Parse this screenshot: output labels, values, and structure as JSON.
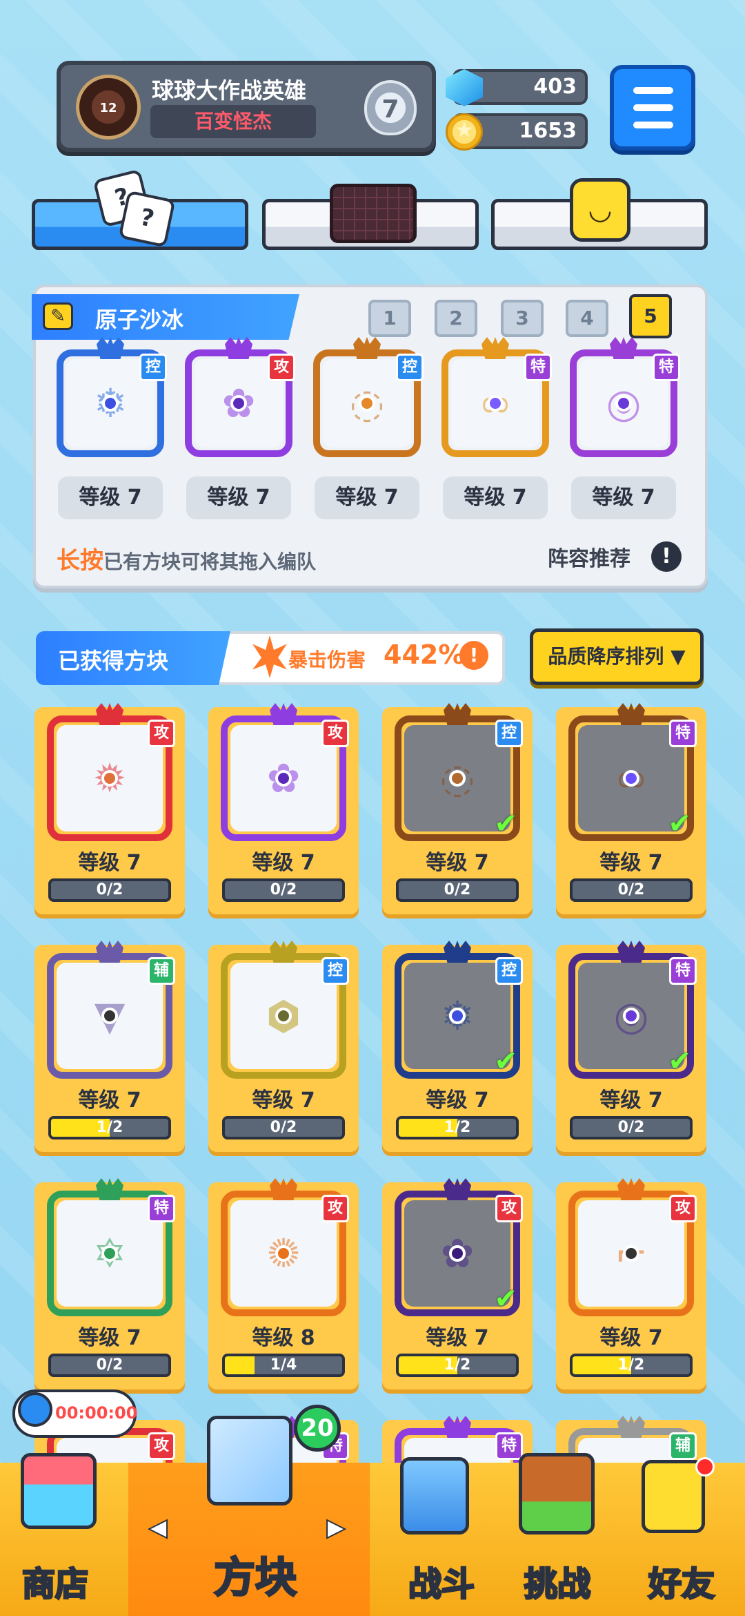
{
  "profile": {
    "level_badge": "12",
    "name": "球球大作战英雄",
    "title": "百变怪杰",
    "rank": "7"
  },
  "currency": {
    "gems": "403",
    "coins": "1653"
  },
  "team": {
    "name": "原子沙冰",
    "slots": [
      "1",
      "2",
      "3",
      "4",
      "5"
    ],
    "active_slot": "5",
    "cards": [
      {
        "tag": "控",
        "level": "等级 7",
        "color": "#2f6fe0",
        "emblem": "❄",
        "dot": "#3c4fe0"
      },
      {
        "tag": "攻",
        "level": "等级 7",
        "color": "#8e3ee0",
        "emblem": "✿",
        "dot": "#5b2ab8"
      },
      {
        "tag": "控",
        "level": "等级 7",
        "color": "#c9741f",
        "emblem": "◌",
        "dot": "#e58a2a"
      },
      {
        "tag": "特",
        "level": "等级 7",
        "color": "#e59a1f",
        "emblem": "∞",
        "dot": "#7a5cff"
      },
      {
        "tag": "特",
        "level": "等级 7",
        "color": "#9a3ed8",
        "emblem": "◎",
        "dot": "#6a3ad8"
      }
    ],
    "hint_strong": "长按",
    "hint_rest": "已有方块可将其拖入编队",
    "recommend": "阵容推荐",
    "excl": "!"
  },
  "acquired": {
    "title": "已获得方块",
    "crit_label": "暴击伤害",
    "crit_value": "442%",
    "excl": "!",
    "sort_label": "品质降序排列 ▼",
    "cards": [
      {
        "tag": "攻",
        "level": "等级 7",
        "progress": "0/2",
        "fill": 0,
        "color": "#e0303a",
        "emblem": "✹",
        "dot": "#e0703a",
        "dim": false
      },
      {
        "tag": "攻",
        "level": "等级 7",
        "progress": "0/2",
        "fill": 0,
        "color": "#8e3ee0",
        "emblem": "✿",
        "dot": "#5b2ab8",
        "dim": false
      },
      {
        "tag": "控",
        "level": "等级 7",
        "progress": "0/2",
        "fill": 0,
        "color": "#8a4a1a",
        "emblem": "◌",
        "dot": "#b06a30",
        "dim": true
      },
      {
        "tag": "特",
        "level": "等级 7",
        "progress": "0/2",
        "fill": 0,
        "color": "#8a4a1a",
        "emblem": "∞",
        "dot": "#6a50ff",
        "dim": true
      },
      {
        "tag": "辅",
        "level": "等级 7",
        "progress": "1/2",
        "fill": 0.5,
        "color": "#6a5aa8",
        "emblem": "▼",
        "dot": "#333",
        "dim": false
      },
      {
        "tag": "控",
        "level": "等级 7",
        "progress": "0/2",
        "fill": 0,
        "color": "#b8a020",
        "emblem": "⬢",
        "dot": "#6b6a30",
        "dim": false
      },
      {
        "tag": "控",
        "level": "等级 7",
        "progress": "1/2",
        "fill": 0.5,
        "color": "#1f3d8a",
        "emblem": "❄",
        "dot": "#3c4fe0",
        "dim": true
      },
      {
        "tag": "特",
        "level": "等级 7",
        "progress": "0/2",
        "fill": 0,
        "color": "#4a2a8a",
        "emblem": "◎",
        "dot": "#6a3ad8",
        "dim": true
      },
      {
        "tag": "特",
        "level": "等级 7",
        "progress": "0/2",
        "fill": 0,
        "color": "#2ea05a",
        "emblem": "✡",
        "dot": "#2ea05a",
        "dim": false
      },
      {
        "tag": "攻",
        "level": "等级 8",
        "progress": "1/4",
        "fill": 0.25,
        "color": "#e8721a",
        "emblem": "✺",
        "dot": "#e8721a",
        "dim": false
      },
      {
        "tag": "攻",
        "level": "等级 7",
        "progress": "1/2",
        "fill": 0.5,
        "color": "#4a2a8a",
        "emblem": "✿",
        "dot": "#3a1a7a",
        "dim": true
      },
      {
        "tag": "攻",
        "level": "等级 7",
        "progress": "1/2",
        "fill": 0.5,
        "color": "#e8721a",
        "emblem": "⌐",
        "dot": "#333",
        "dim": false
      },
      {
        "tag": "攻",
        "color": "#e0303a",
        "emblem": "",
        "dot": "#e0303a",
        "dim": false
      },
      {
        "tag": "特",
        "color": "#9a3ed8",
        "emblem": "",
        "dot": "#9a3ed8",
        "dim": false
      },
      {
        "tag": "特",
        "color": "#8e3ee0",
        "emblem": "",
        "dot": "#8e3ee0",
        "dim": false
      },
      {
        "tag": "辅",
        "color": "#999",
        "emblem": "",
        "dot": "#777",
        "dim": false
      }
    ]
  },
  "timer": "00:00:00",
  "nav": {
    "shop": "商店",
    "blocks": "方块",
    "battle": "战斗",
    "challenge": "挑战",
    "friends": "好友",
    "badge": "20"
  },
  "icons": [
    "gem-icon",
    "coin-icon",
    "menu-icon",
    "dice-icon",
    "grid-icon",
    "smile-icon",
    "pencil-icon",
    "crit-icon",
    "clock-icon"
  ]
}
